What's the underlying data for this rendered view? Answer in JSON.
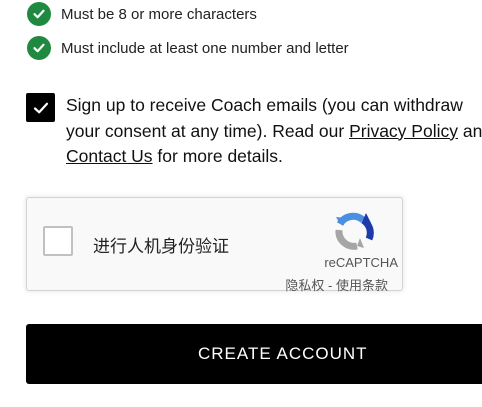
{
  "password_requirements": [
    {
      "text": "Must be 8 or more characters",
      "icon": "check-circle-icon",
      "met": true
    },
    {
      "text": "Must include at least one number and letter",
      "icon": "check-circle-icon",
      "met": true
    }
  ],
  "consent": {
    "checked": true,
    "text_before": "Sign up to receive Coach emails (you can withdraw your consent at any time). Read our ",
    "privacy_link": "Privacy Policy",
    "text_middle": " and ",
    "contact_link": "Contact Us",
    "text_after": " for more details."
  },
  "recaptcha": {
    "label": "进行人机身份验证",
    "brand": "reCAPTCHA",
    "privacy": "隐私权",
    "separator": " - ",
    "terms": "使用条款",
    "checked": false
  },
  "create_account": {
    "label": "CREATE ACCOUNT"
  },
  "colors": {
    "check_green": "#1f8a3f",
    "button_bg": "#000000",
    "button_text": "#ffffff"
  }
}
